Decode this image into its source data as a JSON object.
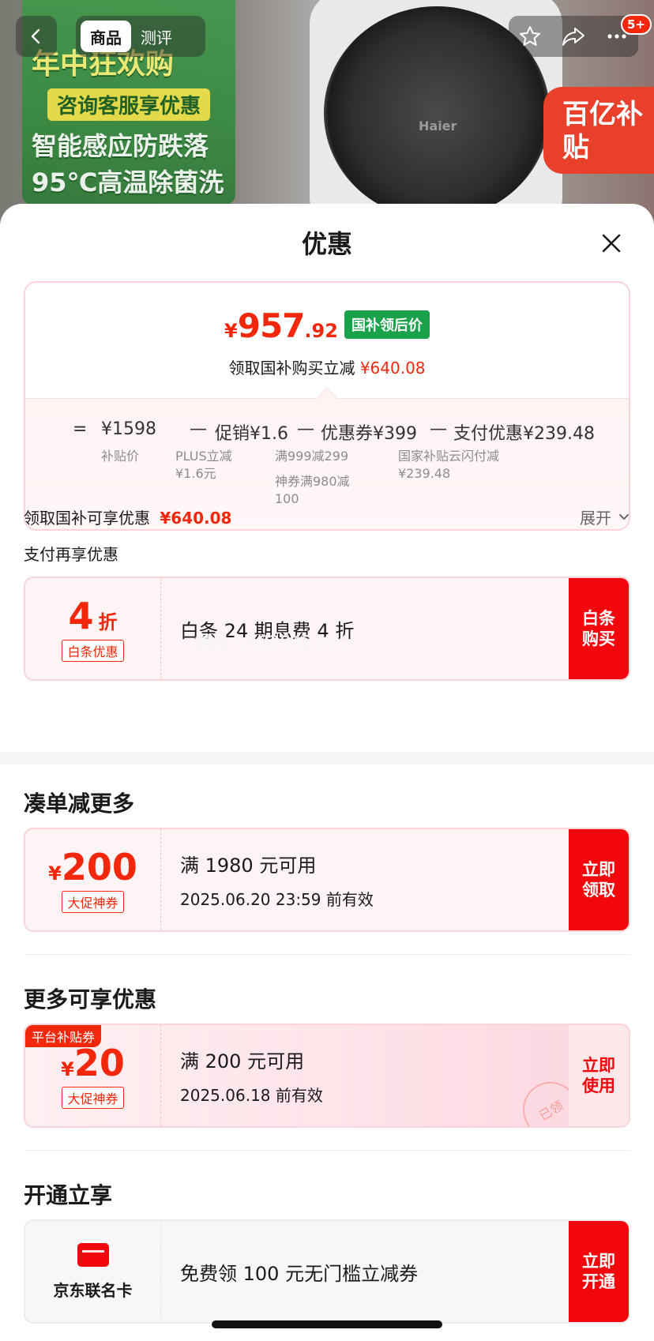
{
  "background": {
    "poster_lines": [
      "年中狂欢购",
      "咨询客服享优惠",
      "智能感应防跌落",
      "95℃高温除菌洗"
    ],
    "drum_logo": "Haier",
    "subsidy_badge": "百亿补贴"
  },
  "nav": {
    "tabs": [
      {
        "label": "商品",
        "active": true
      },
      {
        "label": "测评",
        "active": false
      }
    ],
    "badge": "5+"
  },
  "sheet": {
    "title": "优惠",
    "summary": {
      "price_currency": "¥",
      "price_int": "957",
      "price_dec": ".92",
      "price_tag": "国补领后价",
      "desc_prefix": "领取国补购买立减",
      "desc_amount": "¥640.08",
      "formula": {
        "eq": "=",
        "base": "¥1598",
        "minus1": "—",
        "promo": "促销¥1.6",
        "minus2": "—",
        "coupon": "优惠券¥399",
        "minus3": "—",
        "pay": "支付优惠¥239.48"
      },
      "formula_sub": {
        "base": "补贴价",
        "promo": "PLUS立减\n¥1.6元",
        "coupon1": "满999减299",
        "coupon2": "神券满980减\n100",
        "pay": "国家补贴云闪付减\n¥239.48"
      }
    },
    "subsidy_line": {
      "label": "领取国补可享优惠",
      "amount": "¥640.08",
      "expand": "展开"
    },
    "pay_line": "支付再享优惠",
    "watermark": "慢星人4630423SK",
    "baitiao_card": {
      "amount": "4",
      "unit": "折",
      "tag": "白条优惠",
      "main": "白条 24 期息费 4 折",
      "button": "白条购买"
    },
    "section_more_order": "凑单减更多",
    "coupon_200": {
      "currency": "¥",
      "amount": "200",
      "tag": "大促神券",
      "main": "满 1980 元可用",
      "sub": "2025.06.20 23:59 前有效",
      "button": "立即领取"
    },
    "section_more": "更多可享优惠",
    "coupon_20": {
      "platform_tag": "平台补贴券",
      "currency": "¥",
      "amount": "20",
      "tag": "大促神券",
      "main": "满 200 元可用",
      "sub": "2025.06.18 前有效",
      "button": "立即使用",
      "stamp": "已领"
    },
    "section_open": "开通立享",
    "jd_card": {
      "name": "京东联名卡",
      "main": "免费领 100 元无门槛立减券",
      "button": "立即开通"
    }
  },
  "colors": {
    "accent": "#f2270c",
    "green_tag": "#1aa24a",
    "card_border": "#f9d4d8"
  }
}
